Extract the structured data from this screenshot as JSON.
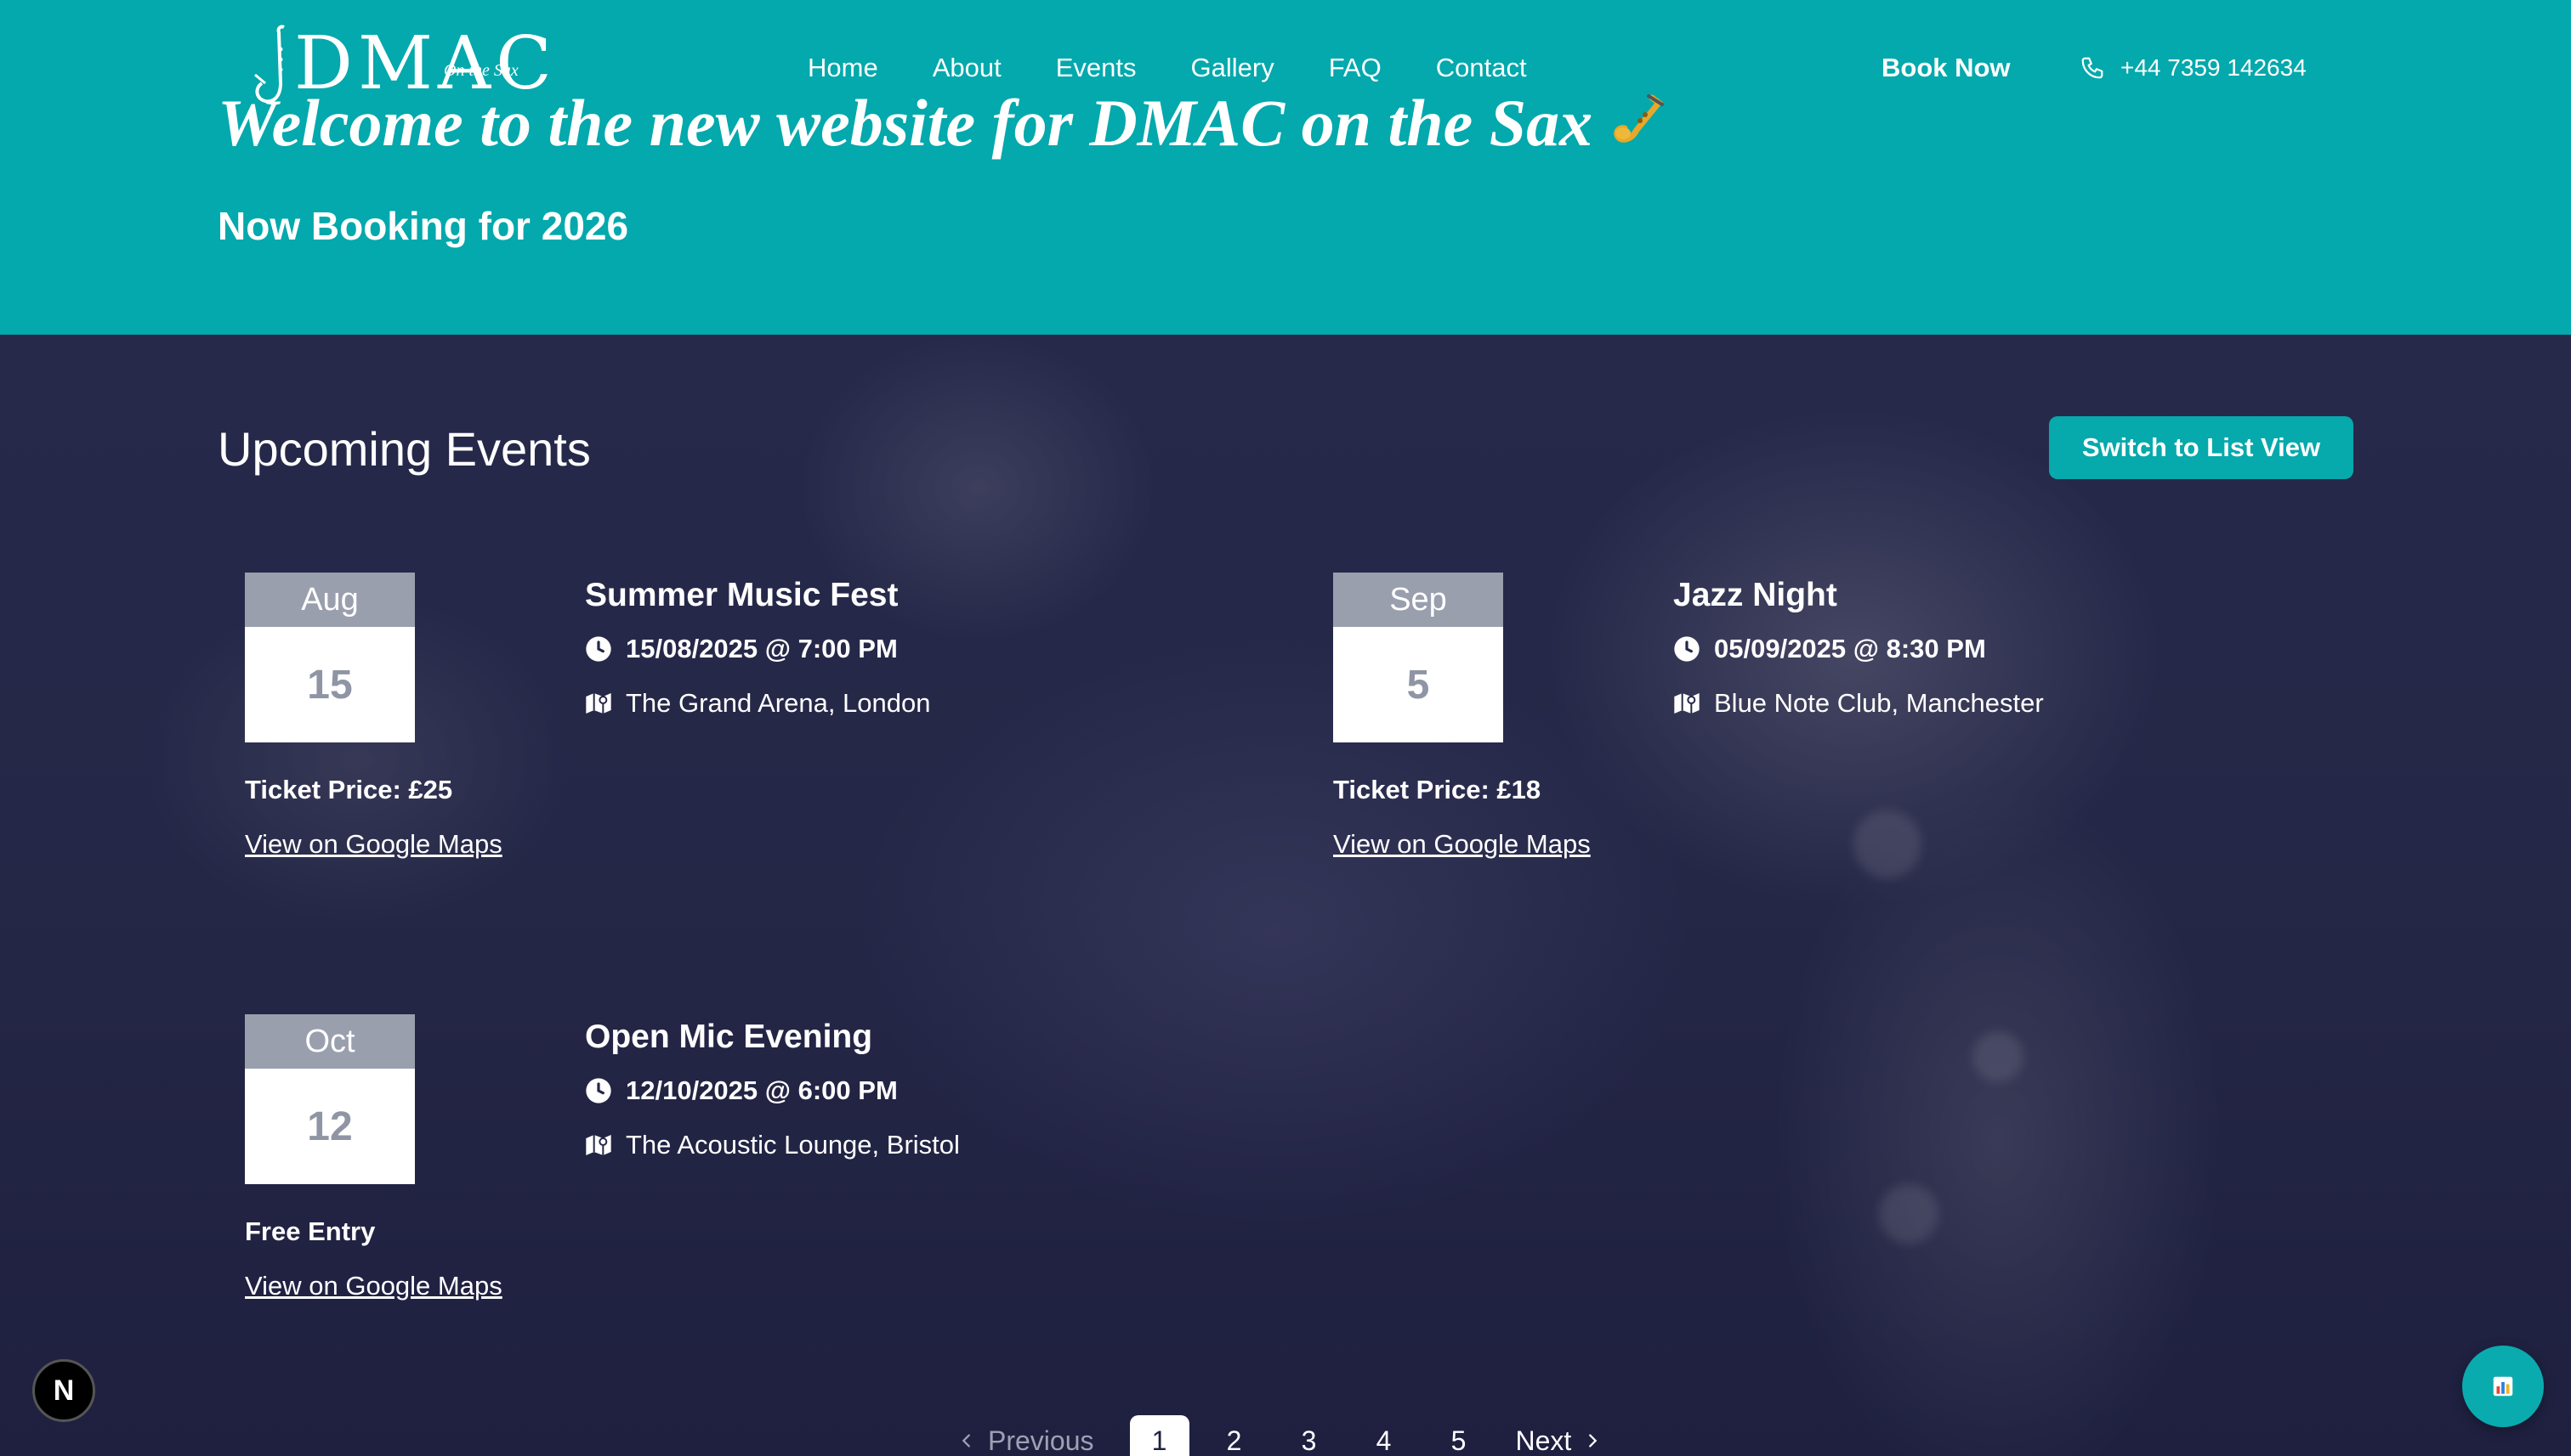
{
  "brand": {
    "logo_text": "DMAC",
    "logo_sub": "On the Sax"
  },
  "nav": {
    "items": [
      "Home",
      "About",
      "Events",
      "Gallery",
      "FAQ",
      "Contact"
    ],
    "book_label": "Book Now",
    "phone": "+44 7359 142634"
  },
  "hero": {
    "title": "Welcome to the new website for DMAC on the Sax",
    "subtitle": "Now Booking for 2026"
  },
  "events_section": {
    "title": "Upcoming Events",
    "switch_label": "Switch to List View",
    "events": [
      {
        "month": "Aug",
        "day": "15",
        "name": "Summer Music Fest",
        "datetime": "15/08/2025 @ 7:00 PM",
        "venue": "The Grand Arena, London",
        "price": "Ticket Price: £25",
        "maps_label": "View on Google Maps"
      },
      {
        "month": "Sep",
        "day": "5",
        "name": "Jazz Night",
        "datetime": "05/09/2025 @ 8:30 PM",
        "venue": "Blue Note Club, Manchester",
        "price": "Ticket Price: £18",
        "maps_label": "View on Google Maps"
      },
      {
        "month": "Oct",
        "day": "12",
        "name": "Open Mic Evening",
        "datetime": "12/10/2025 @ 6:00 PM",
        "venue": "The Acoustic Lounge, Bristol",
        "price": "Free Entry",
        "maps_label": "View on Google Maps"
      }
    ]
  },
  "pagination": {
    "prev_label": "Previous",
    "next_label": "Next",
    "pages": [
      "1",
      "2",
      "3",
      "4",
      "5"
    ],
    "current": "1"
  },
  "badges": {
    "next_badge": "N"
  },
  "icons": {
    "phone": "phone-icon",
    "clock": "clock-icon",
    "map": "map-icon",
    "saxophone": "saxophone-icon",
    "chart": "chart-icon"
  },
  "colors": {
    "header_bg": "#03a9ac",
    "accent": "#06a9ac",
    "section_bg": "#1f2040",
    "calendar_month_bg": "#9a9fae"
  }
}
